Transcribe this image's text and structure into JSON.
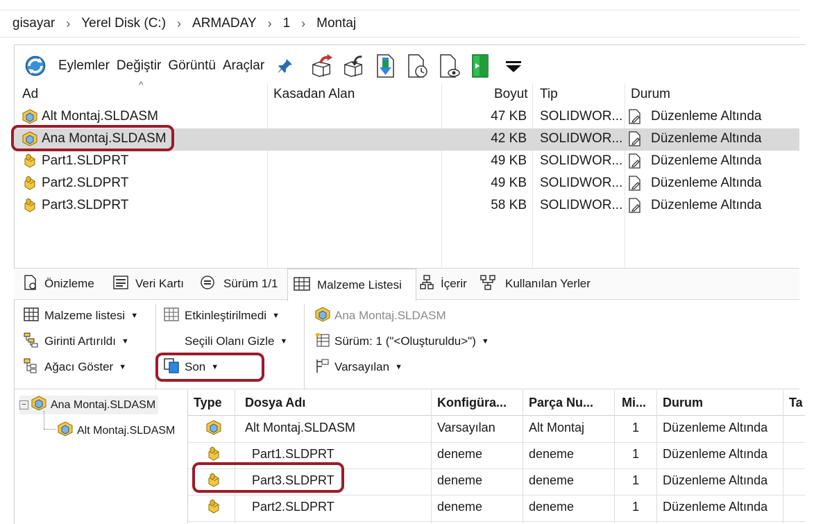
{
  "breadcrumb": [
    "gisayar",
    "Yerel Disk (C:)",
    "ARMADAY",
    "1",
    "Montaj"
  ],
  "toolbar": {
    "menus": [
      "Eylemler",
      "Değiştir",
      "Görüntü",
      "Araçlar"
    ],
    "icons": [
      "refresh-icon",
      "pin-icon",
      "check-out-icon",
      "check-in-icon",
      "get-latest-icon",
      "get-version-icon",
      "preview-icon",
      "exit-icon",
      "more-icon"
    ]
  },
  "file_list": {
    "columns": {
      "name": "Ad",
      "checked_out_by": "Kasadan Alan",
      "size": "Boyut",
      "type": "Tip",
      "state": "Durum"
    },
    "rows": [
      {
        "name": "Alt Montaj.SLDASM",
        "size": "47 KB",
        "type": "SOLIDWOR...",
        "state": "Düzenleme Altında",
        "kind": "assembly",
        "selected": false
      },
      {
        "name": "Ana Montaj.SLDASM",
        "size": "42 KB",
        "type": "SOLIDWOR...",
        "state": "Düzenleme Altında",
        "kind": "assembly",
        "selected": true
      },
      {
        "name": "Part1.SLDPRT",
        "size": "49 KB",
        "type": "SOLIDWOR...",
        "state": "Düzenleme Altında",
        "kind": "part",
        "selected": false
      },
      {
        "name": "Part2.SLDPRT",
        "size": "49 KB",
        "type": "SOLIDWOR...",
        "state": "Düzenleme Altında",
        "kind": "part",
        "selected": false
      },
      {
        "name": "Part3.SLDPRT",
        "size": "58 KB",
        "type": "SOLIDWOR...",
        "state": "Düzenleme Altında",
        "kind": "part",
        "selected": false
      }
    ]
  },
  "tabs": [
    {
      "label": "Önizleme",
      "icon": "preview-icon"
    },
    {
      "label": "Veri Kartı",
      "icon": "data-card-icon"
    },
    {
      "label": "Sürüm 1/1",
      "icon": "version-icon"
    },
    {
      "label": "Malzeme Listesi",
      "icon": "bom-icon",
      "active": true
    },
    {
      "label": "İçerir",
      "icon": "contains-icon"
    },
    {
      "label": "Kullanılan Yerler",
      "icon": "where-used-icon"
    }
  ],
  "bom_toolbar": {
    "bom_type": "Malzeme listesi",
    "indent": "Girinti Artırıldı",
    "show_tree": "Ağacı Göster",
    "activation": "Etkinleştirilmedi",
    "hide_selected": "Seçili Olanı Gizle",
    "version_mode": "Son",
    "file_name": "Ana Montaj.SLDASM",
    "version": "Sürüm: 1 (\"<Oluşturuldu>\")",
    "configuration": "Varsayılan"
  },
  "tree": {
    "root": "Ana Montaj.SLDASM",
    "child": "Alt Montaj.SLDASM"
  },
  "bom_table": {
    "headers": [
      "Type",
      "Dosya Adı",
      "Konfigüra...",
      "Parça Nu...",
      "Mi...",
      "Durum",
      "Ta"
    ],
    "rows": [
      {
        "kind": "assembly",
        "file": "Alt Montaj.SLDASM",
        "config": "Varsayılan",
        "part_no": "Alt Montaj",
        "qty": "1",
        "state": "Düzenleme Altında"
      },
      {
        "kind": "part",
        "file": "Part1.SLDPRT",
        "config": "deneme",
        "part_no": "deneme",
        "qty": "1",
        "state": "Düzenleme Altında"
      },
      {
        "kind": "part",
        "file": "Part3.SLDPRT",
        "config": "deneme",
        "part_no": "deneme",
        "qty": "1",
        "state": "Düzenleme Altında"
      },
      {
        "kind": "part",
        "file": "Part2.SLDPRT",
        "config": "deneme",
        "part_no": "deneme",
        "qty": "1",
        "state": "Düzenleme Altında"
      }
    ]
  },
  "colors": {
    "highlight": "#9b1c2a",
    "selected_row": "#d9d9d9",
    "part_icon": "#e8b62c",
    "assembly_icon": "#f2c744",
    "exit_green": "#1f9e3a"
  }
}
